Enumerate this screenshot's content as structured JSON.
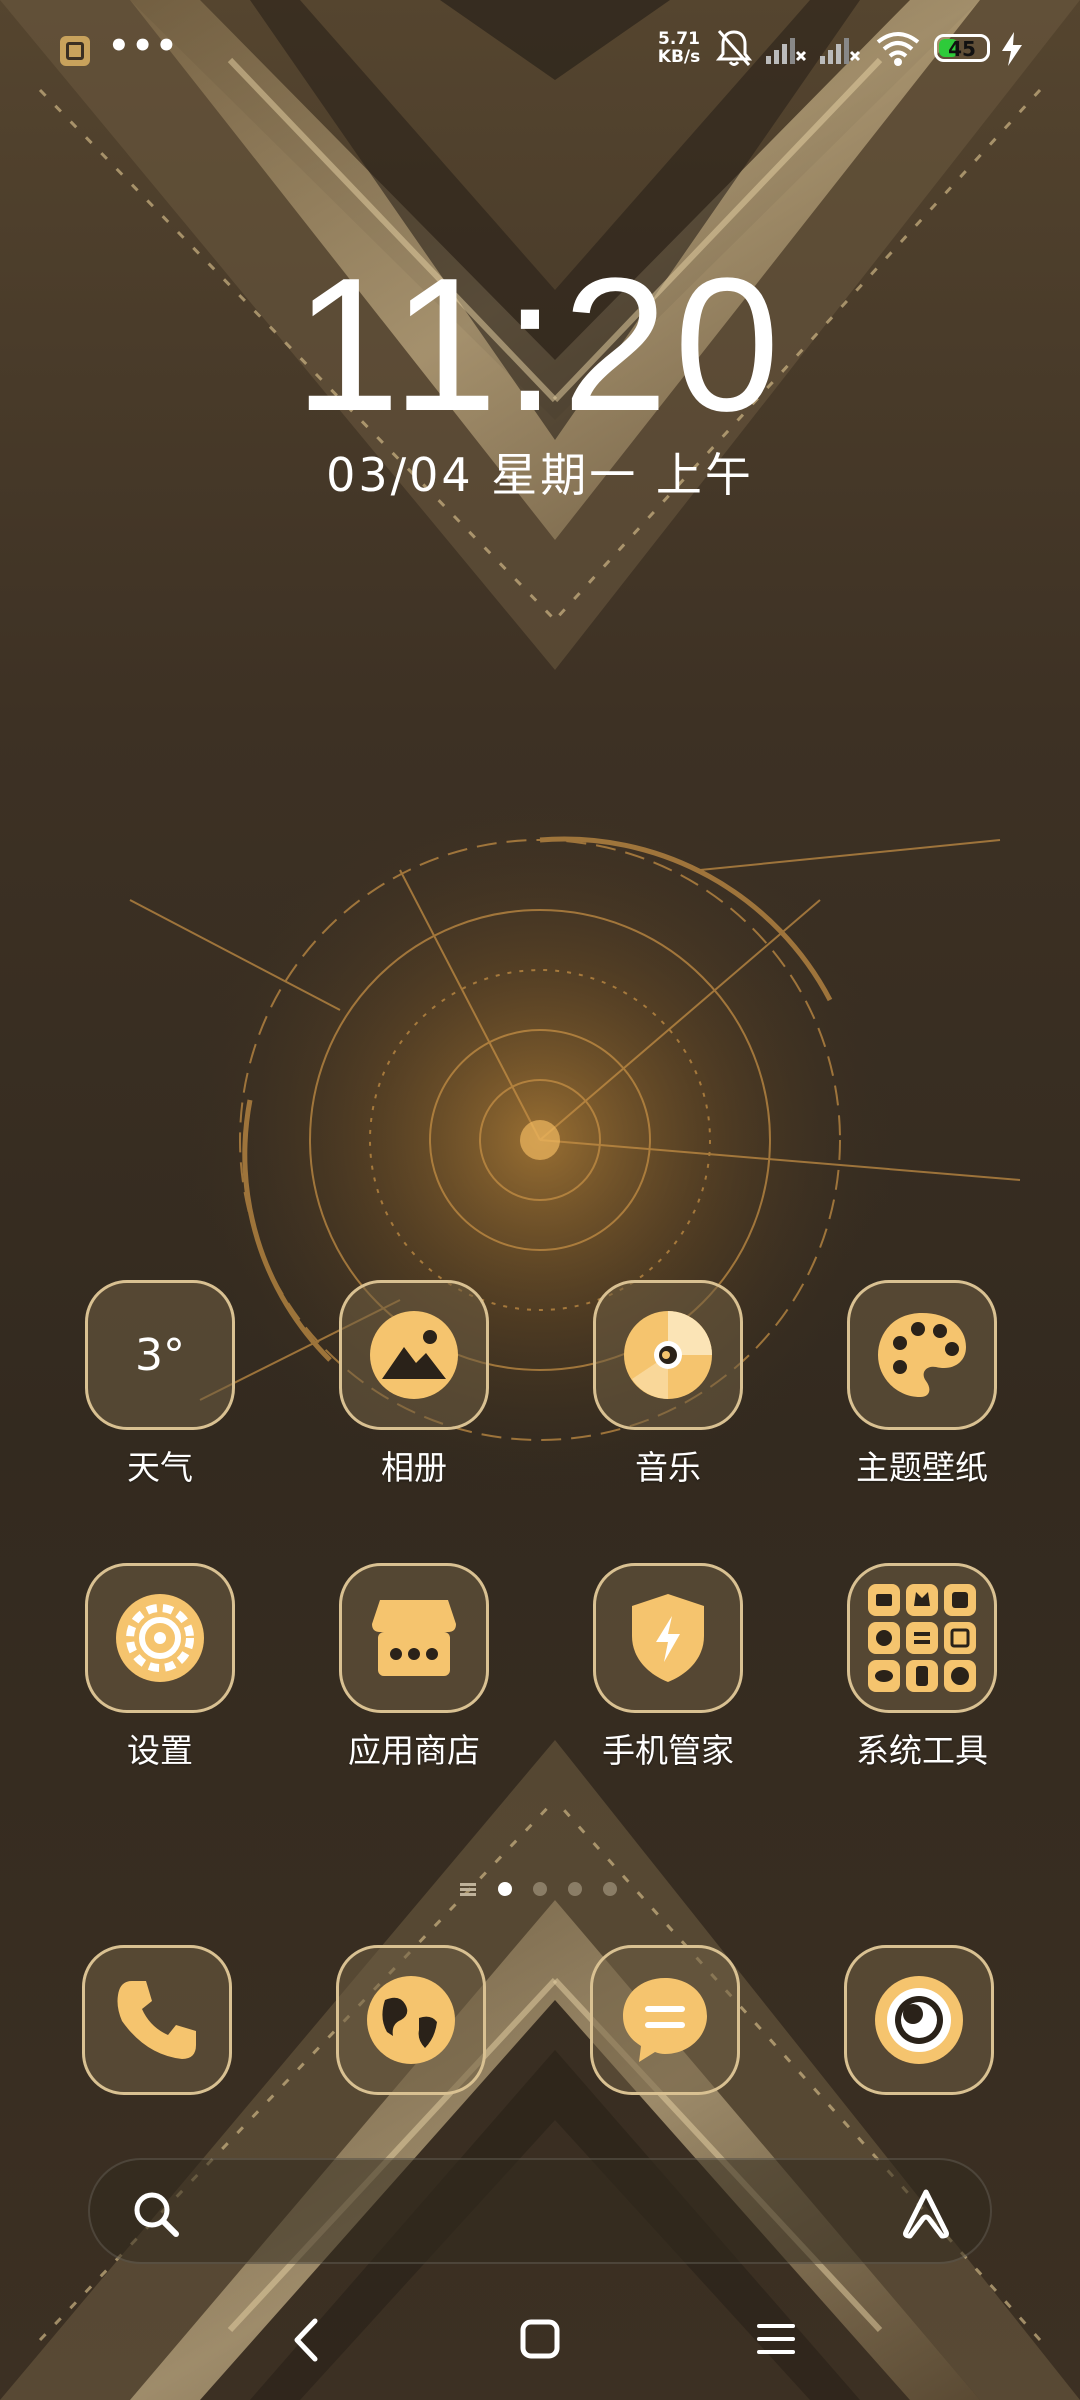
{
  "status_bar": {
    "net_speed_value": "5.71",
    "net_speed_unit": "KB/s",
    "battery_level": "45",
    "battery_percent": 45,
    "icons": [
      "app-notification-icon",
      "more-dots-icon",
      "mute-bell-icon",
      "signal-sim1-icon",
      "signal-sim2-icon",
      "wifi-icon",
      "battery-icon",
      "charging-bolt-icon"
    ],
    "more": "•••"
  },
  "lockscreen": {
    "time": "11:20",
    "date": "03/04 星期一 上午"
  },
  "apps_row1": [
    {
      "label": "天气",
      "icon": "weather-icon",
      "temp": "3°"
    },
    {
      "label": "相册",
      "icon": "gallery-icon"
    },
    {
      "label": "音乐",
      "icon": "music-icon"
    },
    {
      "label": "主题壁纸",
      "icon": "palette-icon"
    }
  ],
  "apps_row2": [
    {
      "label": "设置",
      "icon": "settings-gear-icon"
    },
    {
      "label": "应用商店",
      "icon": "app-store-icon"
    },
    {
      "label": "手机管家",
      "icon": "security-shield-icon"
    },
    {
      "label": "系统工具",
      "icon": "system-tools-folder-icon"
    }
  ],
  "page_indicator": {
    "pages": 4,
    "current": 0
  },
  "dock": [
    {
      "icon": "phone-icon"
    },
    {
      "icon": "browser-icon"
    },
    {
      "icon": "messages-icon"
    },
    {
      "icon": "camera-icon"
    }
  ],
  "search_bar": {
    "left_icon": "search-icon",
    "right_icon": "assistant-icon"
  },
  "nav_bar": {
    "icons": [
      "back-icon",
      "home-icon",
      "recents-icon"
    ]
  },
  "colors": {
    "accent": "#f5c46e",
    "tile_border": "#d9c192",
    "background": "#3a2f22",
    "battery_fill": "#2ecb3a"
  }
}
